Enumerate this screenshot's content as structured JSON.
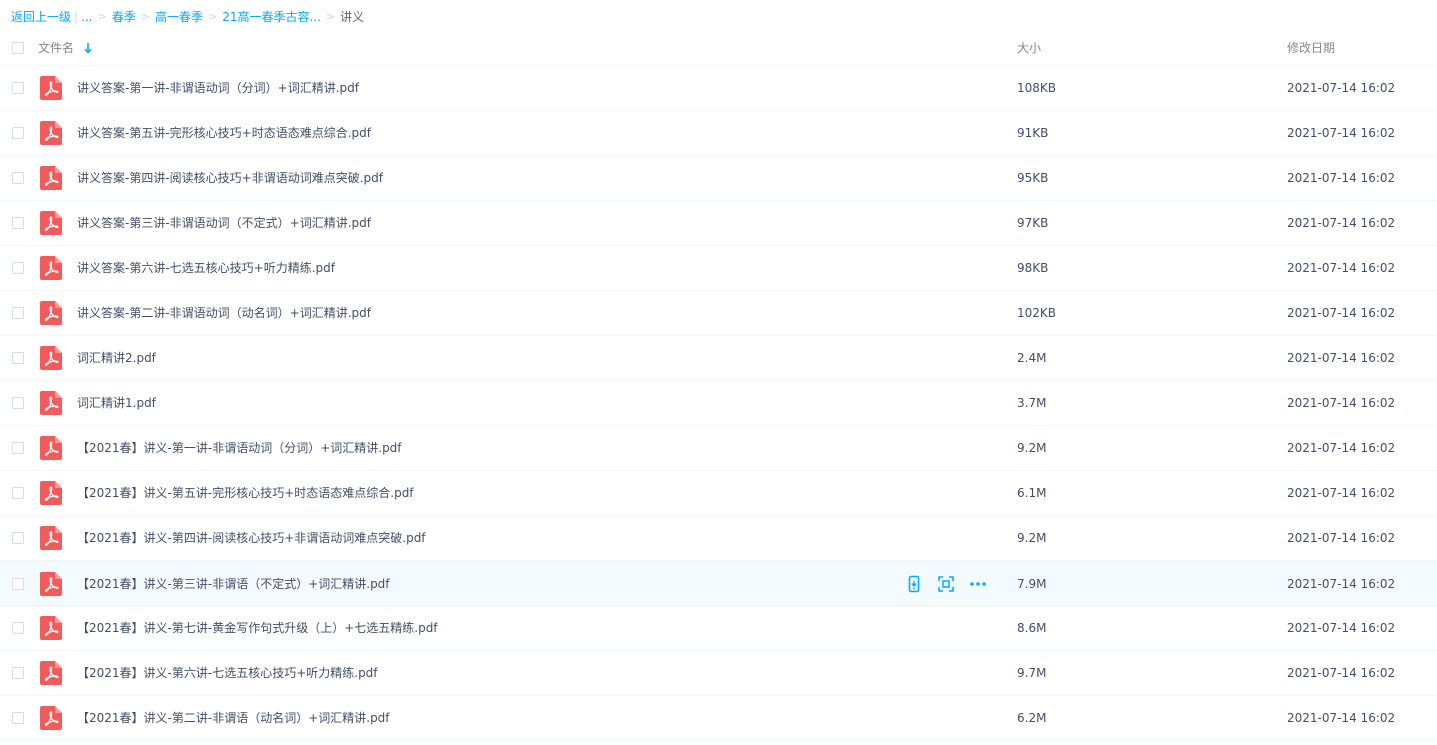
{
  "breadcrumb": {
    "back": "返回上一级",
    "divider": "|",
    "ellipsis": "...",
    "crumbs": [
      "春季",
      "高一春季",
      "21高一春季古容..."
    ],
    "current": "讲义"
  },
  "header": {
    "name": "文件名",
    "size": "大小",
    "date": "修改日期"
  },
  "files": [
    {
      "name": "讲义答案-第一讲-非谓语动词（分词）+词汇精讲.pdf",
      "size": "108KB",
      "date": "2021-07-14 16:02"
    },
    {
      "name": "讲义答案-第五讲-完形核心技巧+时态语态难点综合.pdf",
      "size": "91KB",
      "date": "2021-07-14 16:02"
    },
    {
      "name": "讲义答案-第四讲-阅读核心技巧+非谓语动词难点突破.pdf",
      "size": "95KB",
      "date": "2021-07-14 16:02"
    },
    {
      "name": "讲义答案-第三讲-非谓语动词（不定式）+词汇精讲.pdf",
      "size": "97KB",
      "date": "2021-07-14 16:02"
    },
    {
      "name": "讲义答案-第六讲-七选五核心技巧+听力精练.pdf",
      "size": "98KB",
      "date": "2021-07-14 16:02"
    },
    {
      "name": "讲义答案-第二讲-非谓语动词（动名词）+词汇精讲.pdf",
      "size": "102KB",
      "date": "2021-07-14 16:02"
    },
    {
      "name": "词汇精讲2.pdf",
      "size": "2.4M",
      "date": "2021-07-14 16:02"
    },
    {
      "name": "词汇精讲1.pdf",
      "size": "3.7M",
      "date": "2021-07-14 16:02"
    },
    {
      "name": "【2021春】讲义-第一讲-非谓语动词（分词）+词汇精讲.pdf",
      "size": "9.2M",
      "date": "2021-07-14 16:02"
    },
    {
      "name": "【2021春】讲义-第五讲-完形核心技巧+时态语态难点综合.pdf",
      "size": "6.1M",
      "date": "2021-07-14 16:02"
    },
    {
      "name": "【2021春】讲义-第四讲-阅读核心技巧+非谓语动词难点突破.pdf",
      "size": "9.2M",
      "date": "2021-07-14 16:02"
    },
    {
      "name": "【2021春】讲义-第三讲-非谓语（不定式）+词汇精讲.pdf",
      "size": "7.9M",
      "date": "2021-07-14 16:02"
    },
    {
      "name": "【2021春】讲义-第七讲-黄金写作句式升级（上）+七选五精练.pdf",
      "size": "8.6M",
      "date": "2021-07-14 16:02"
    },
    {
      "name": "【2021春】讲义-第六讲-七选五核心技巧+听力精练.pdf",
      "size": "9.7M",
      "date": "2021-07-14 16:02"
    },
    {
      "name": "【2021春】讲义-第二讲-非谓语（动名词）+词汇精讲.pdf",
      "size": "6.2M",
      "date": "2021-07-14 16:02"
    }
  ],
  "hovered_row": 11,
  "icons": {
    "file": "pdf-file-icon",
    "sort": "sort-down-arrow-icon",
    "row_actions": [
      "phone-send-icon",
      "scan-share-icon",
      "more-dots-icon"
    ]
  },
  "colors": {
    "link": "#09aaff",
    "pdf_red": "#f25b5b",
    "hover_bg": "#f4fbff",
    "text": "#424e67"
  }
}
